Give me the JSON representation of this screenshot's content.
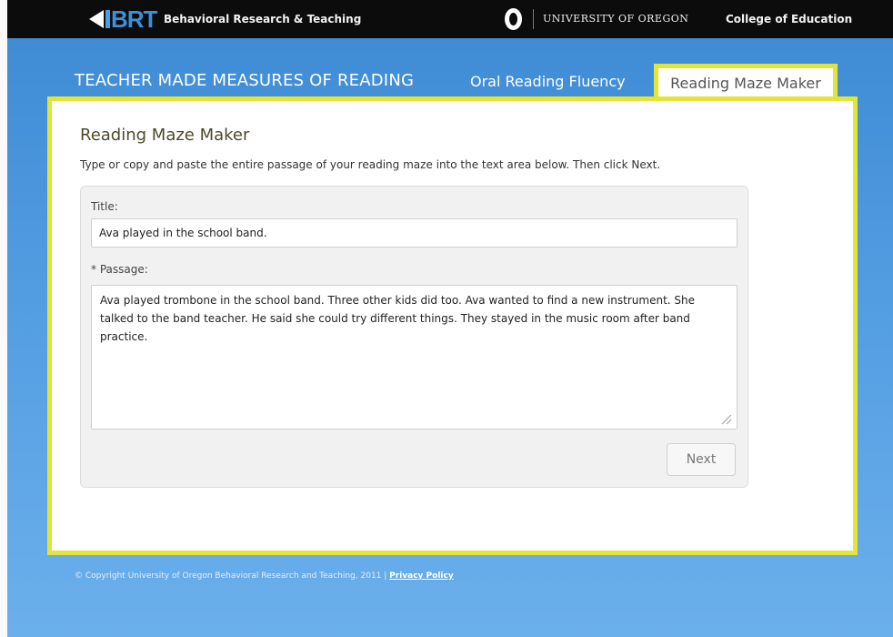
{
  "header": {
    "brand": "BRT",
    "org_name": "Behavioral Research & Teaching",
    "university": "UNIVERSITY OF OREGON",
    "college": "College of Education"
  },
  "nav": {
    "site_title": "TEACHER MADE MEASURES OF READING",
    "tabs": [
      {
        "label": "Oral Reading Fluency",
        "active": false
      },
      {
        "label": "Reading Maze Maker",
        "active": true
      }
    ]
  },
  "main": {
    "title": "Reading Maze Maker",
    "instructions": "Type or copy and paste the entire passage of your reading maze into the text area below. Then click Next.",
    "form": {
      "title_label": "Title:",
      "title_value": "Ava played in the school band.",
      "passage_required_marker": "*",
      "passage_label": " Passage:",
      "passage_value": "Ava played trombone in the school band. Three other kids did too. Ava wanted to find a new instrument. She talked to the band teacher. He said she could try different things. They stayed in the music room after band practice.",
      "next_label": "Next"
    }
  },
  "footer": {
    "copyright": "© Copyright University of Oregon Behavioral Research and Teaching, 2011 | ",
    "privacy_label": "Privacy Policy"
  },
  "colors": {
    "highlight_border": "#e3e43a",
    "top_bar": "#0c0c0c",
    "background_blue": "#4f9ae0"
  }
}
